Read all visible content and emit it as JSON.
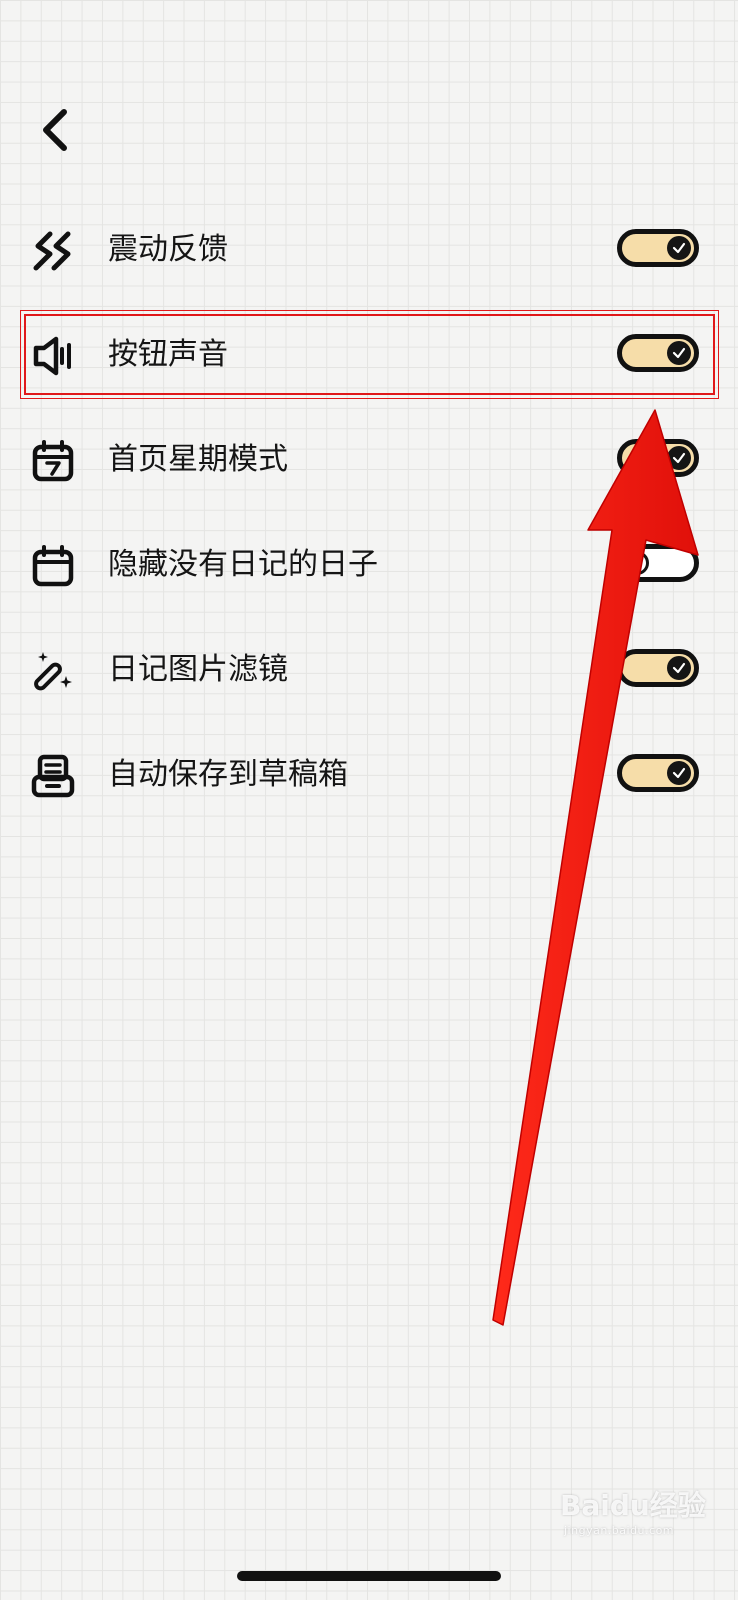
{
  "header": {
    "back_icon": "chevron-left-icon"
  },
  "settings": [
    {
      "label": "震动反馈",
      "icon": "vibration-icon",
      "enabled": true
    },
    {
      "label": "按钮声音",
      "icon": "speaker-icon",
      "enabled": true
    },
    {
      "label": "首页星期模式",
      "icon": "calendar-week-icon",
      "enabled": true
    },
    {
      "label": "隐藏没有日记的日子",
      "icon": "calendar-icon",
      "enabled": false
    },
    {
      "label": "日记图片滤镜",
      "icon": "magic-wand-icon",
      "enabled": true
    },
    {
      "label": "自动保存到草稿箱",
      "icon": "inbox-tray-icon",
      "enabled": true
    }
  ],
  "annotation": {
    "highlight_color": "#e0181a",
    "arrow_color": "#ff1a1a"
  },
  "colors": {
    "toggle_on": "#f6dda9",
    "toggle_off": "#ffffff",
    "outline": "#111111",
    "background": "#f4f4f3"
  },
  "watermark": {
    "text": "Baidu经验",
    "sub": "jingyan.baidu.com"
  }
}
